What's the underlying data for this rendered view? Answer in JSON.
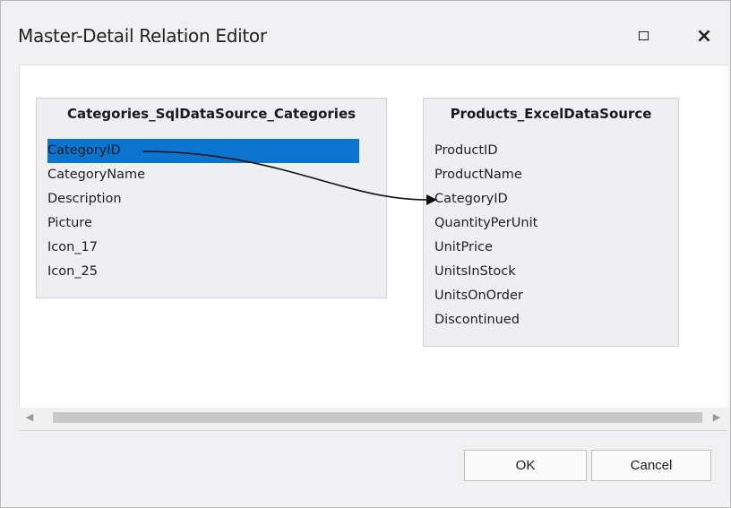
{
  "window": {
    "title": "Master-Detail Relation Editor",
    "maximize_icon": "maximize-icon",
    "close_glyph": "×"
  },
  "master": {
    "name": "Categories_SqlDataSource_Categories",
    "fields": [
      "CategoryID",
      "CategoryName",
      "Description",
      "Picture",
      "Icon_17",
      "Icon_25"
    ],
    "selected_field": "CategoryID"
  },
  "detail": {
    "name": "Products_ExcelDataSource",
    "fields": [
      "ProductID",
      "ProductName",
      "CategoryID",
      "QuantityPerUnit",
      "UnitPrice",
      "UnitsInStock",
      "UnitsOnOrder",
      "Discontinued"
    ]
  },
  "relation": {
    "from": "CategoryID",
    "to": "CategoryID"
  },
  "scrollbar": {
    "left_arrow": "◀",
    "right_arrow": "▶"
  },
  "buttons": {
    "ok_label": "OK",
    "cancel_label": "Cancel"
  },
  "colors": {
    "selection": "#0a74cf",
    "table_bg": "#efeff3"
  }
}
